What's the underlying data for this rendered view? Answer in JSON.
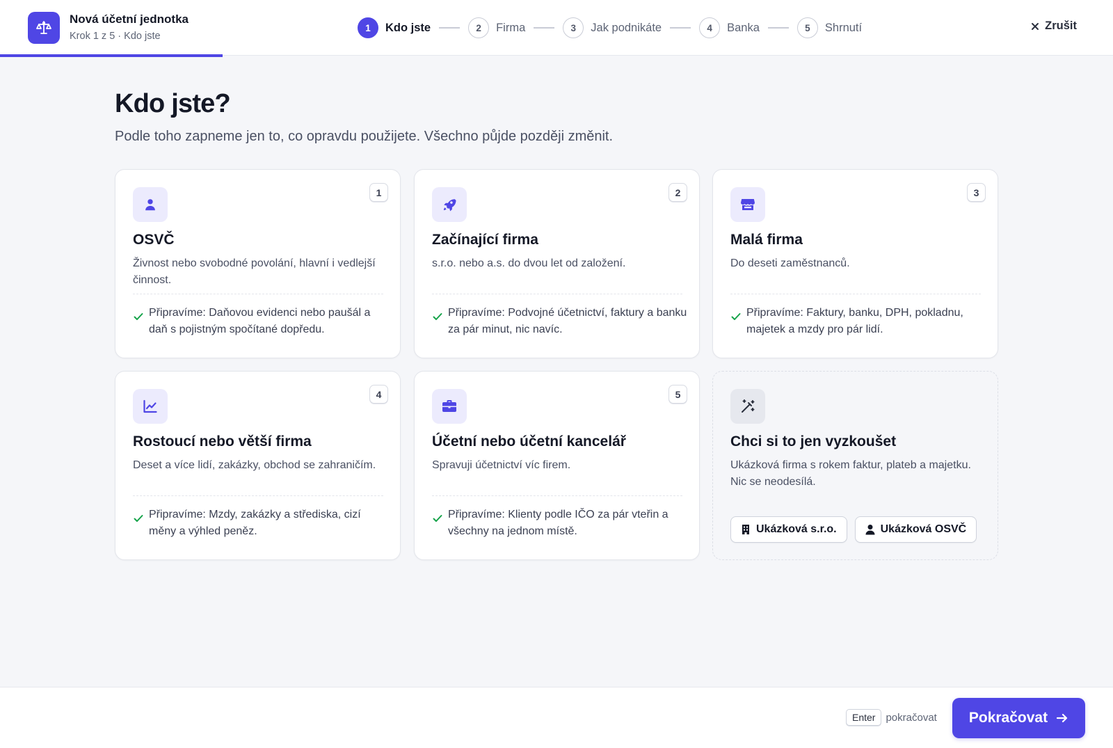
{
  "header": {
    "title": "Nová účetní jednotka",
    "subtitle": "Krok 1 z 5 · Kdo jste",
    "progress_fraction": 0.2,
    "cancel_label": "Zrušit",
    "steps": [
      {
        "number": "1",
        "label": "Kdo jste",
        "active": true
      },
      {
        "number": "2",
        "label": "Firma",
        "active": false
      },
      {
        "number": "3",
        "label": "Jak podnikáte",
        "active": false
      },
      {
        "number": "4",
        "label": "Banka",
        "active": false
      },
      {
        "number": "5",
        "label": "Shrnutí",
        "active": false
      }
    ]
  },
  "main": {
    "title": "Kdo jste?",
    "subtitle": "Podle toho zapneme jen to, co opravdu použijete. Všechno půjde později změnit.",
    "cards": [
      {
        "key": "1",
        "icon": "user-icon",
        "title": "OSVČ",
        "description": "Živnost nebo svobodné povolání, hlavní i vedlejší činnost.",
        "benefit": "Připravíme: Daňovou evidenci nebo paušál a daň s pojistným spočítané dopředu."
      },
      {
        "key": "2",
        "icon": "rocket-icon",
        "title": "Začínající firma",
        "description": "s.r.o. nebo a.s. do dvou let od založení.",
        "benefit": "Připravíme: Podvojné účetnictví, faktury a banku za pár minut, nic navíc."
      },
      {
        "key": "3",
        "icon": "store-icon",
        "title": "Malá firma",
        "description": "Do deseti zaměstnanců.",
        "benefit": "Připravíme: Faktury, banku, DPH, pokladnu, majetek a mzdy pro pár lidí."
      },
      {
        "key": "4",
        "icon": "chart-line-icon",
        "title": "Rostoucí nebo větší firma",
        "description": "Deset a více lidí, zakázky, obchod se zahraničím.",
        "benefit": "Připravíme: Mzdy, zakázky a střediska, cizí měny a výhled peněz."
      },
      {
        "key": "5",
        "icon": "briefcase-icon",
        "title": "Účetní nebo účetní kancelář",
        "description": "Spravuji účetnictví víc firem.",
        "benefit": "Připravíme: Klienty podle IČO za pár vteřin a všechny na jednom místě."
      }
    ],
    "demo_card": {
      "icon": "magic-wand-icon",
      "title": "Chci si to jen vyzkoušet",
      "description": "Ukázková firma s rokem faktur, plateb a majetku. Nic se neodesílá.",
      "buttons": [
        {
          "icon": "building-icon",
          "label": "Ukázková s.r.o."
        },
        {
          "icon": "user-icon",
          "label": "Ukázková OSVČ"
        }
      ]
    }
  },
  "footer": {
    "kbd_key": "Enter",
    "kbd_hint": "pokračovat",
    "primary_label": "Pokračovat"
  },
  "colors": {
    "accent": "#4f46e5",
    "accent_soft": "#ecebfd",
    "success": "#16a34a",
    "background": "#f5f6f9"
  }
}
